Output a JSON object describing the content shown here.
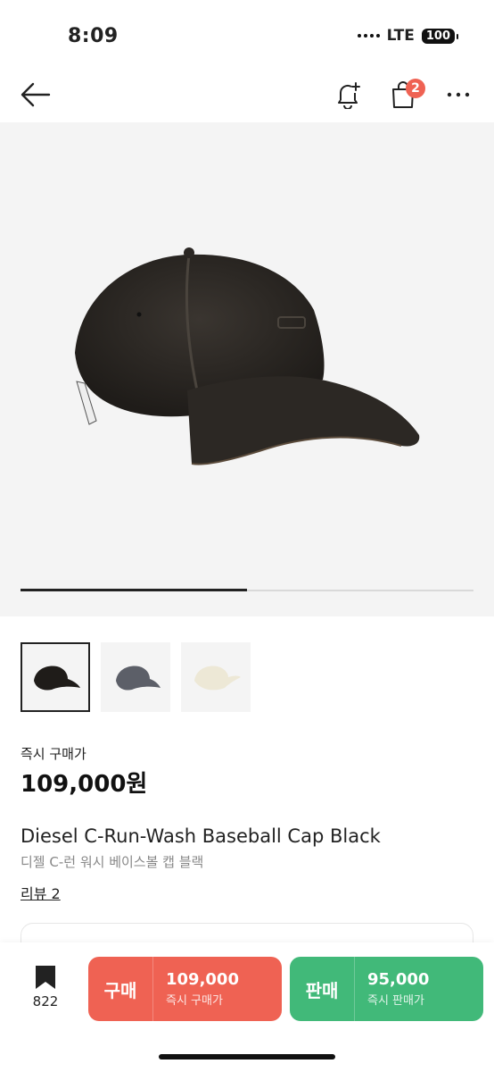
{
  "status_bar": {
    "time": "8:09",
    "network": "LTE",
    "battery": "100"
  },
  "nav": {
    "cart_count": "2"
  },
  "gallery": {
    "progress": 0.5
  },
  "product": {
    "price_label": "즉시 구매가",
    "price": "109,000원",
    "name_en": "Diesel C-Run-Wash Baseball Cap Black",
    "name_ko": "디젤 C-런 워시 베이스볼 캡 블랙",
    "review_link": "리뷰 2"
  },
  "bottom": {
    "bookmark_count": "822",
    "buy": {
      "label": "구매",
      "price": "109,000",
      "sub": "즉시 구매가"
    },
    "sell": {
      "label": "판매",
      "price": "95,000",
      "sub": "즉시 판매가"
    }
  },
  "colors": {
    "buy": "#ef6253",
    "sell": "#41b979",
    "badge": "#ef6253"
  }
}
